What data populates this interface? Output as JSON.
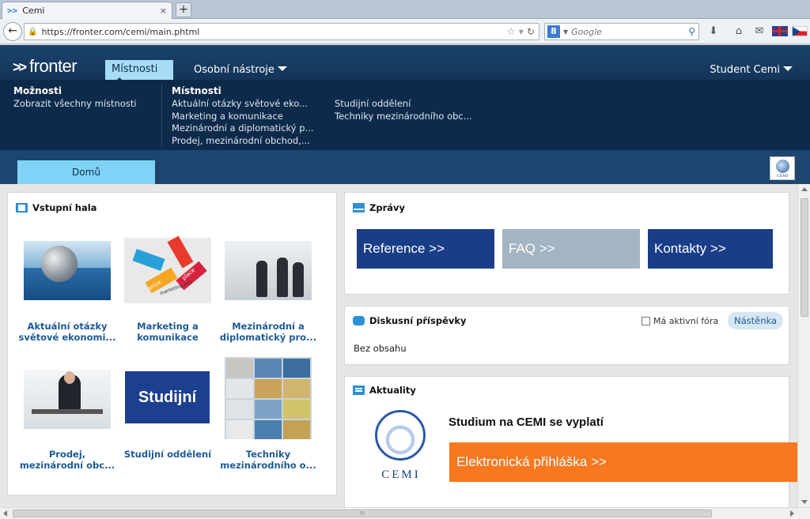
{
  "browser": {
    "tab_title": "Cemi",
    "tab_close": "×",
    "new_tab": "+",
    "url": "https://fronter.com/cemi/main.phtml",
    "search_placeholder": "Google",
    "search_engine_letter": "8"
  },
  "header": {
    "logo": "fronter",
    "logo_arrows": ">>",
    "nav_mistnosti": "Místnosti",
    "nav_osobni": "Osobní nástroje",
    "user": "Student Cemi"
  },
  "dropdown": {
    "col1_title": "Možnosti",
    "col1_items": [
      "Zobrazit všechny místnosti"
    ],
    "col2_title": "Místnosti",
    "col2_items": [
      "Aktuální otázky světové eko...",
      "Marketing a komunikace",
      "Mezinárodní a diplomatický p...",
      "Prodej, mezinárodní obchod,..."
    ],
    "col3_items": [
      "Studijní oddělení",
      "Techniky mezinárodního obc..."
    ]
  },
  "subbar": {
    "home_tab": "Domů",
    "badge_text": "CEMI"
  },
  "hall": {
    "title": "Vstupní hala",
    "tiles": [
      {
        "label_l1": "Aktuální otázky",
        "label_l2": "světové ekonomi..."
      },
      {
        "label_l1": "Marketing a",
        "label_l2": "komunikace"
      },
      {
        "label_l1": "Mezinárodní a",
        "label_l2": "diplomatický pro..."
      },
      {
        "label_l1": "Prodej,",
        "label_l2": "mezinárodní obc..."
      },
      {
        "label_l1": "Studijní oddělení",
        "label_l2": ""
      },
      {
        "label_l1": "Techniky",
        "label_l2": "mezinárodního o..."
      }
    ],
    "mix_words": [
      "price",
      "marketing mix",
      "place"
    ],
    "studijni_text": "Studijní"
  },
  "zpravy": {
    "title": "Zprávy",
    "buttons": [
      "Reference >>",
      "FAQ >>",
      "Kontakty >>"
    ],
    "colors": [
      "#1a3d88",
      "#a3b5c3",
      "#1a3d88"
    ]
  },
  "diskuse": {
    "title": "Diskusní příspěvky",
    "checkbox_label": "Má aktivní fóra",
    "pill": "Nástěnka",
    "empty": "Bez obsahu"
  },
  "aktuality": {
    "title": "Aktuality",
    "headline": "Studium na CEMI se vyplatí",
    "button": "Elektronická přihláška >>",
    "logo_text": "CEMI"
  },
  "scrollbar": {
    "grip": "III"
  }
}
